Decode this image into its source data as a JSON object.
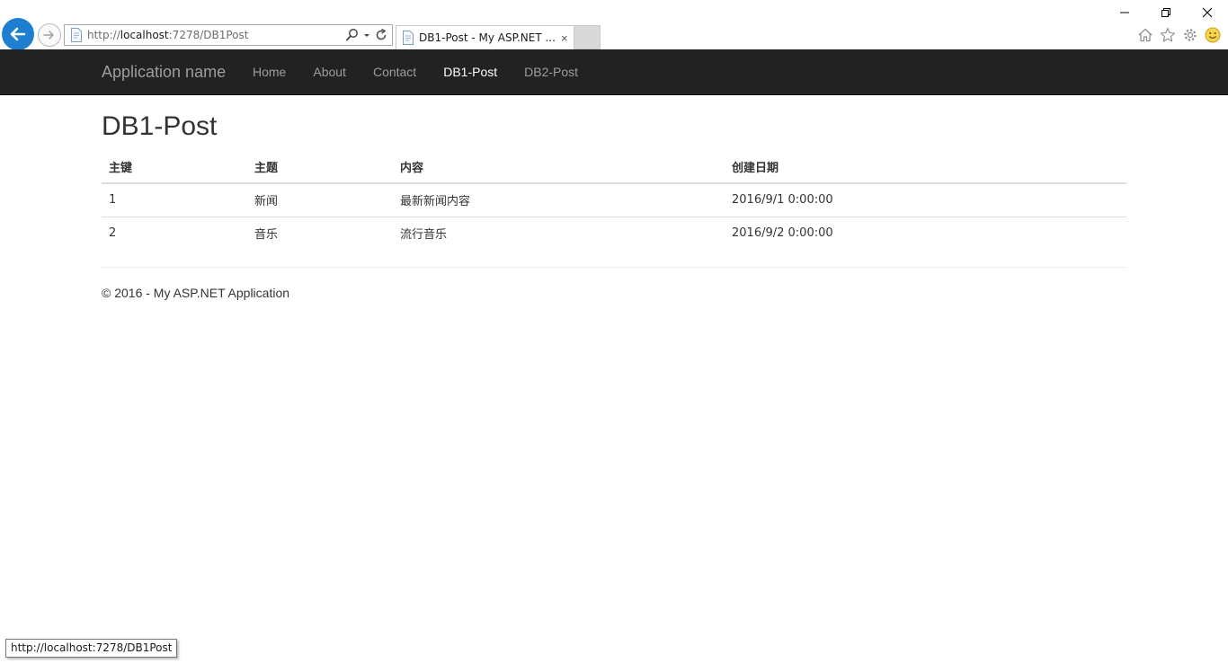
{
  "browser": {
    "address_prefix": "http://",
    "address_host": "localhost",
    "address_suffix": ":7278/DB1Post",
    "tab_title": "DB1-Post - My ASP.NET ...",
    "tab_close": "×",
    "icons": [
      "back-arrow-icon",
      "forward-arrow-icon",
      "page-icon",
      "search-icon",
      "dropdown-arrow-icon",
      "refresh-icon",
      "home-icon",
      "star-icon",
      "gear-icon",
      "smiley-icon",
      "minimize-icon",
      "restore-icon",
      "close-icon"
    ],
    "accent_color": "#1e7fd0"
  },
  "navbar": {
    "brand": "Application name",
    "items": [
      {
        "label": "Home",
        "active": false
      },
      {
        "label": "About",
        "active": false
      },
      {
        "label": "Contact",
        "active": false
      },
      {
        "label": "DB1-Post",
        "active": true
      },
      {
        "label": "DB2-Post",
        "active": false
      }
    ],
    "background": "#222222"
  },
  "main": {
    "title": "DB1-Post",
    "table": {
      "headers": [
        "主键",
        "主题",
        "内容",
        "创建日期"
      ],
      "rows": [
        [
          "1",
          "新闻",
          "最新新闻内容",
          "2016/9/1 0:00:00"
        ],
        [
          "2",
          "音乐",
          "流行音乐",
          "2016/9/2 0:00:00"
        ]
      ]
    }
  },
  "footer": {
    "text": "© 2016 - My ASP.NET Application"
  },
  "statusbar": {
    "text": "http://localhost:7278/DB1Post"
  }
}
